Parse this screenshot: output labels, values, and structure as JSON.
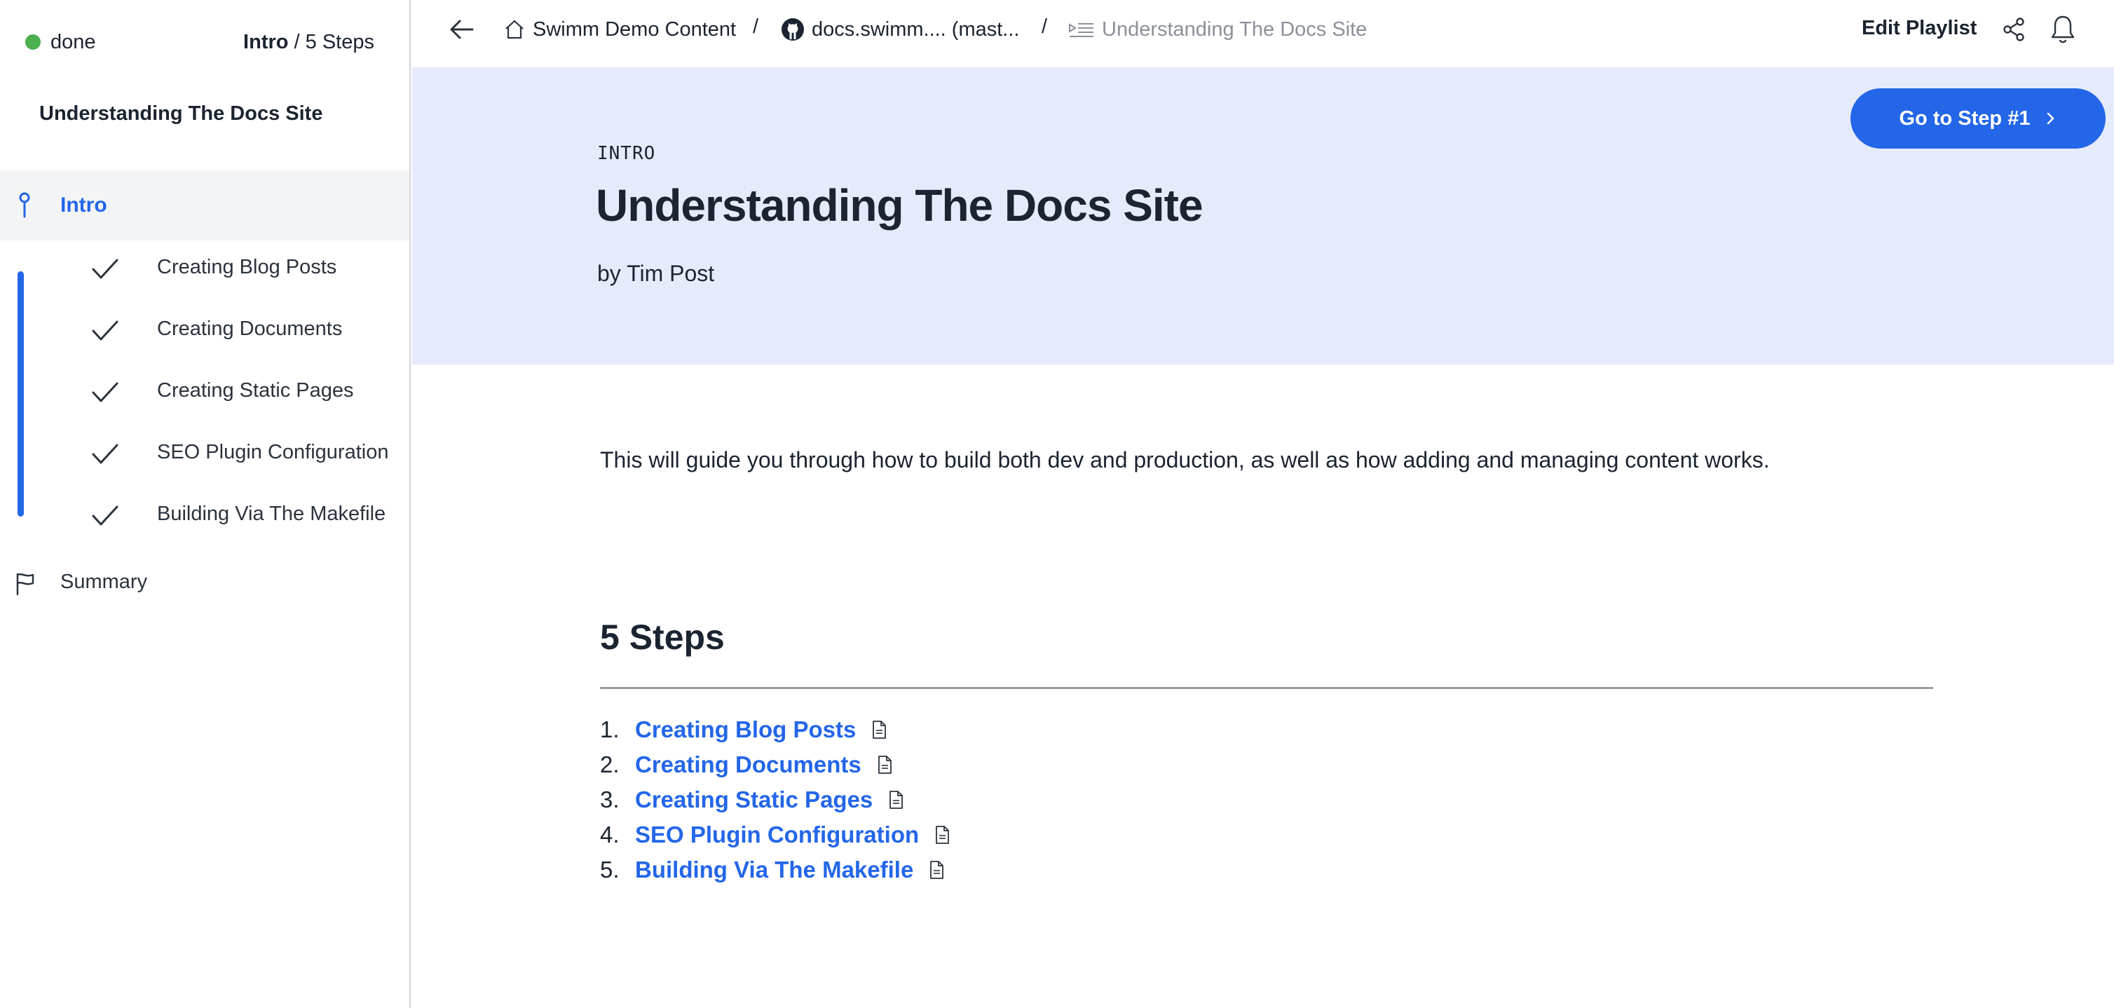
{
  "sidebar": {
    "status": "done",
    "progress_current": "Intro",
    "progress_sep": " / ",
    "progress_total": "5 Steps",
    "title": "Understanding The Docs Site",
    "intro_label": "Intro",
    "steps": [
      {
        "label": "Creating Blog Posts"
      },
      {
        "label": "Creating Documents"
      },
      {
        "label": "Creating Static Pages"
      },
      {
        "label": "SEO Plugin Configuration"
      },
      {
        "label": "Building Via The Makefile"
      }
    ],
    "summary_label": "Summary"
  },
  "topbar": {
    "crumb_repo_home": "Swimm Demo Content",
    "crumb_repo": "docs.swimm.... (mast...",
    "crumb_current": "Understanding The Docs Site",
    "separator": "/",
    "edit_playlist": "Edit Playlist"
  },
  "hero": {
    "kicker": "INTRO",
    "title": "Understanding The Docs Site",
    "byline": "by Tim Post",
    "go_button": "Go to Step #1"
  },
  "content": {
    "intro_text": "This will guide you through how to build both dev and production, as well as how adding and managing content works.",
    "steps_heading": "5 Steps",
    "steps": [
      {
        "num": "1.",
        "label": "Creating Blog Posts"
      },
      {
        "num": "2.",
        "label": "Creating Documents"
      },
      {
        "num": "3.",
        "label": "Creating Static Pages"
      },
      {
        "num": "4.",
        "label": "SEO Plugin Configuration"
      },
      {
        "num": "5.",
        "label": "Building Via The Makefile"
      }
    ]
  },
  "colors": {
    "accent": "#2366e8",
    "hero_bg": "#e5ebfb",
    "status_done": "#4caf50"
  },
  "icons": [
    "back-arrow-icon",
    "home-icon",
    "github-icon",
    "playlist-icon",
    "share-icon",
    "bell-icon",
    "pin-icon",
    "check-icon",
    "flag-icon",
    "chevron-right-icon",
    "document-icon"
  ]
}
